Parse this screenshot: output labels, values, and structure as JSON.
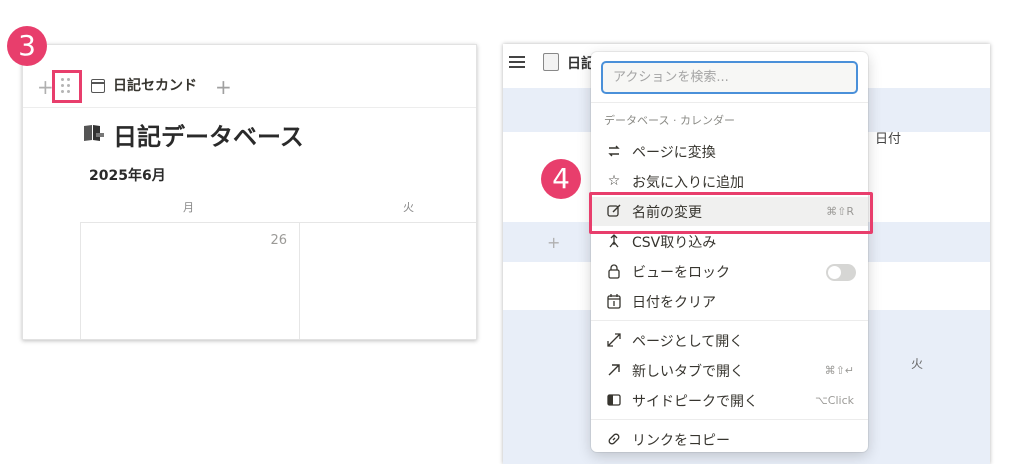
{
  "steps": {
    "step3": "3",
    "step4": "4"
  },
  "left_panel": {
    "tab_label": "日記セカンド",
    "add_symbol": "+",
    "title": "日記データベース",
    "month": "2025年6月",
    "weekdays": [
      "月",
      "火"
    ],
    "date": "26"
  },
  "right_panel": {
    "page_title": "日記",
    "column_header": "日付",
    "weekday": "火",
    "add_symbol": "+"
  },
  "menu": {
    "search_placeholder": "アクションを検索...",
    "section_label": "データベース · カレンダー",
    "items": [
      {
        "icon": "convert-icon",
        "label": "ページに変換"
      },
      {
        "icon": "star-icon",
        "label": "お気に入りに追加"
      },
      {
        "icon": "edit-icon",
        "label": "名前の変更",
        "shortcut": "⌘⇧R"
      },
      {
        "icon": "import-icon",
        "label": "CSV取り込み"
      },
      {
        "icon": "lock-icon",
        "label": "ビューをロック"
      },
      {
        "icon": "calendar-icon",
        "label": "日付をクリア"
      },
      {
        "icon": "expand-icon",
        "label": "ページとして開く"
      },
      {
        "icon": "arrow-up-right-icon",
        "label": "新しいタブで開く",
        "shortcut": "⌘⇧↵"
      },
      {
        "icon": "side-peek-icon",
        "label": "サイドピークで開く",
        "shortcut": "⌥Click"
      },
      {
        "icon": "link-icon",
        "label": "リンクをコピー"
      }
    ]
  },
  "colors": {
    "highlight": "#e83e6c",
    "focus": "#4a90d9",
    "band": "#e8eef8"
  }
}
